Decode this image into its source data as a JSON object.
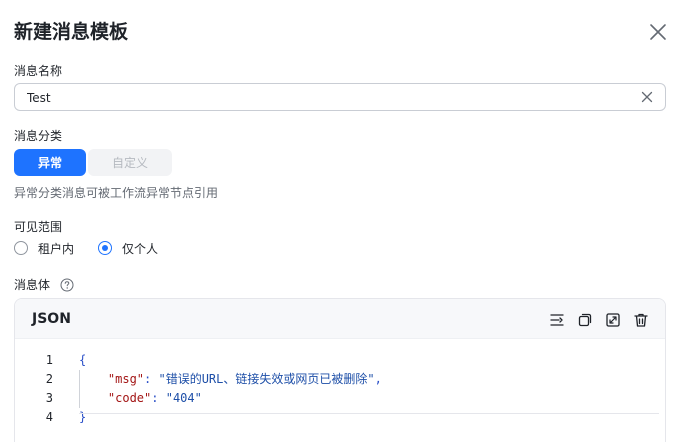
{
  "dialog": {
    "title": "新建消息模板"
  },
  "name_field": {
    "label": "消息名称",
    "value": "Test"
  },
  "category": {
    "label": "消息分类",
    "options": [
      "异常",
      "自定义"
    ],
    "selected": "异常",
    "hint": "异常分类消息可被工作流异常节点引用"
  },
  "visibility": {
    "label": "可见范围",
    "options": [
      "租户内",
      "仅个人"
    ],
    "selected": "仅个人"
  },
  "body": {
    "label": "消息体",
    "editor_lang": "JSON",
    "toolbar_icons": [
      "format-icon",
      "copy-icon",
      "fullscreen-icon",
      "delete-icon"
    ],
    "line_numbers": [
      "1",
      "2",
      "3",
      "4"
    ],
    "code": {
      "open_brace": "{",
      "line2_key": "\"msg\"",
      "line2_value": "\"错误的URL、链接失效或网页已被删除\"",
      "line3_key": "\"code\"",
      "line3_value": "\"404\"",
      "close_brace": "}"
    }
  },
  "colors": {
    "accent": "#1e73ff",
    "text": "#1f2329",
    "muted": "#646a73"
  }
}
